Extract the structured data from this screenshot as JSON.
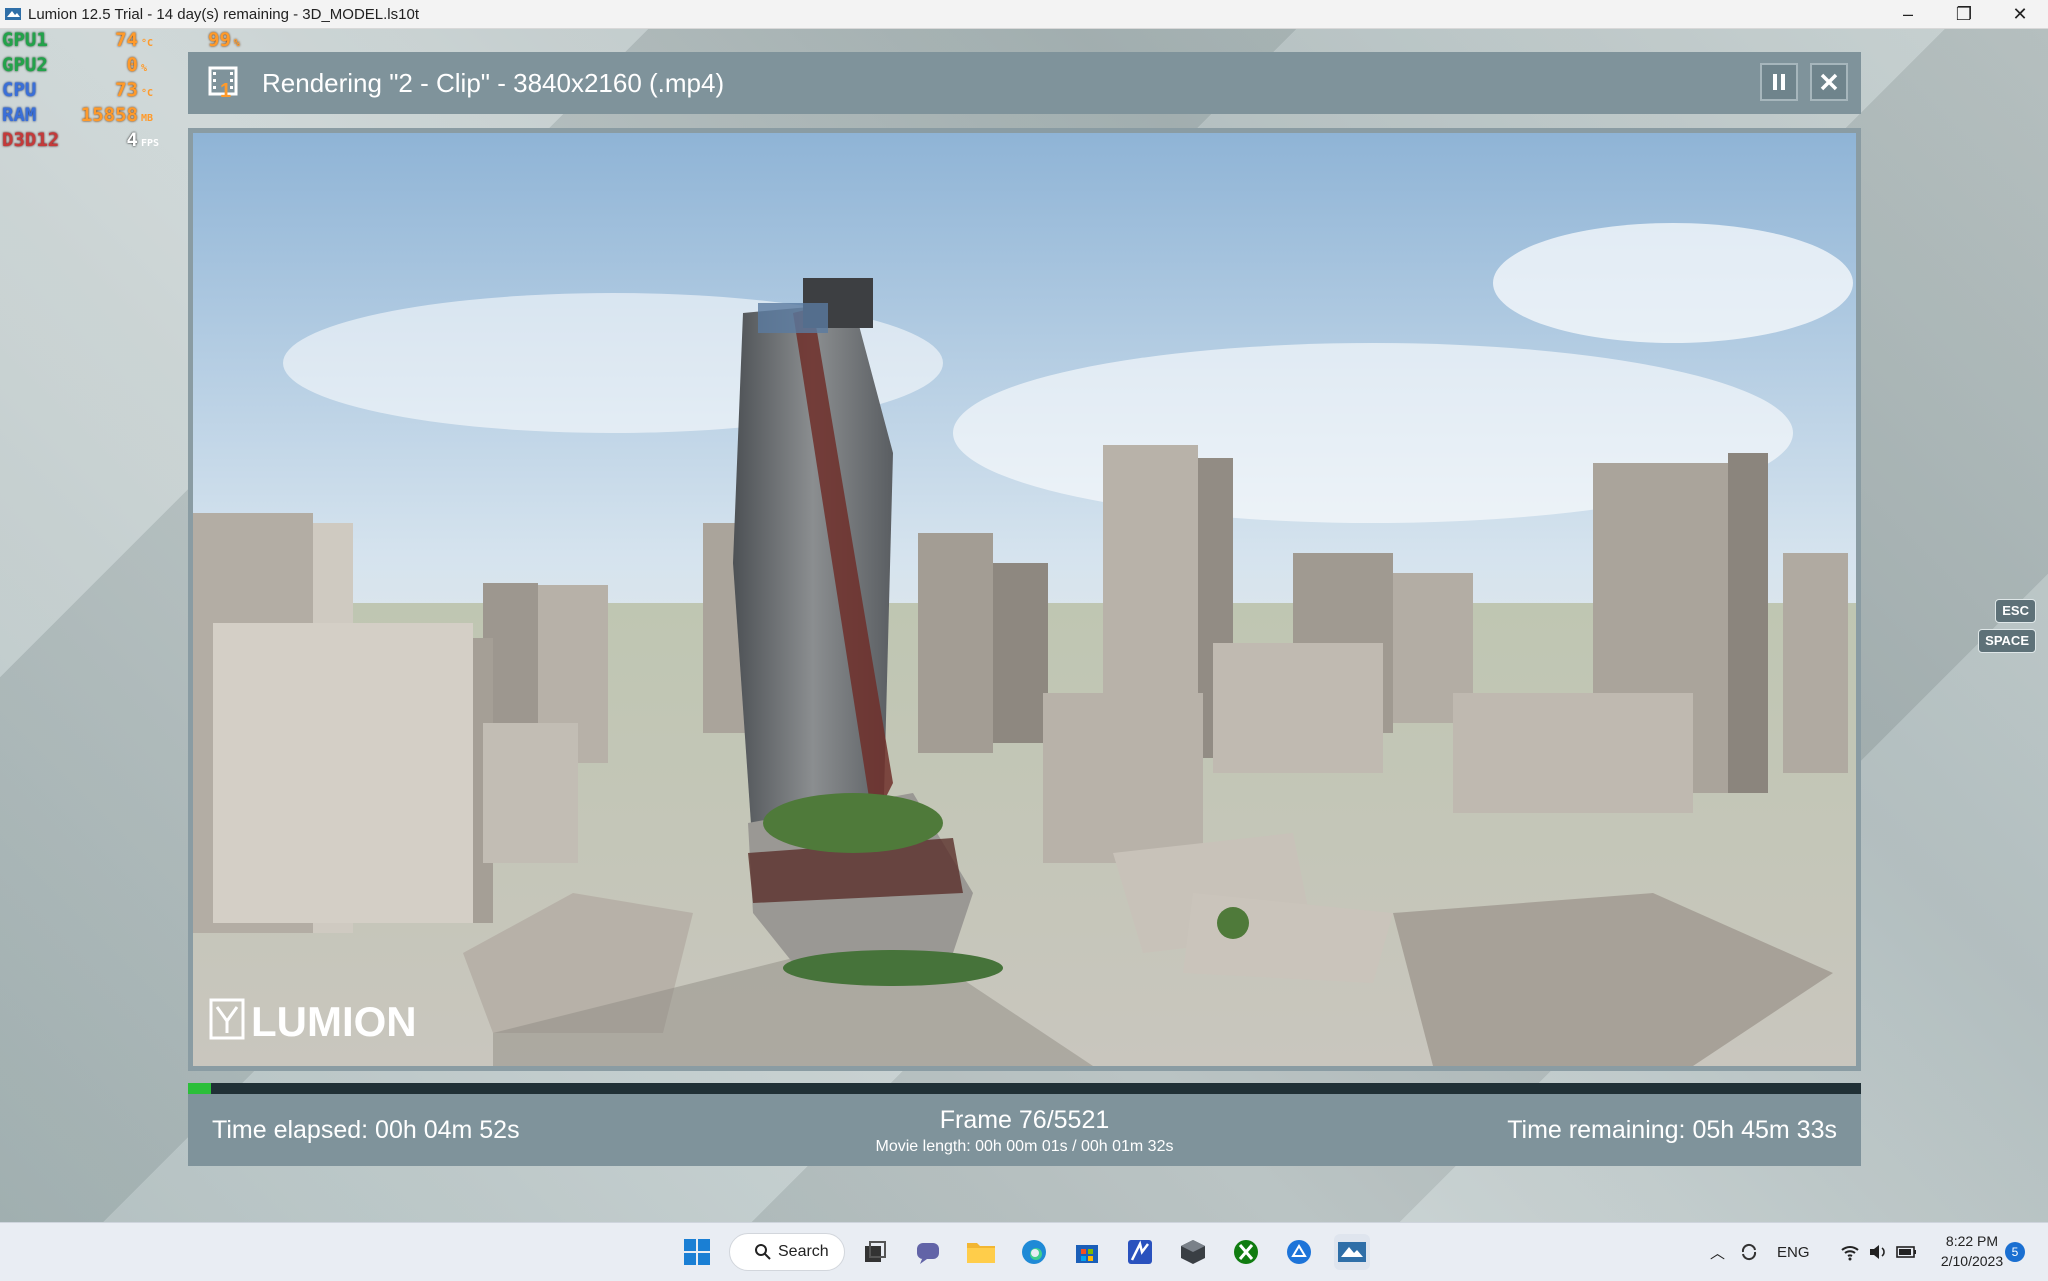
{
  "window": {
    "title": "Lumion 12.5 Trial - 14 day(s) remaining - 3D_MODEL.ls10t",
    "minimize": "–",
    "restore": "❐",
    "close": "✕"
  },
  "overlay": {
    "rows": [
      {
        "label": "GPU1",
        "value": "74",
        "unit": "°C"
      },
      {
        "label": "GPU2",
        "value": "0",
        "unit": "%"
      },
      {
        "label": "CPU",
        "value": "73",
        "unit": "°C"
      },
      {
        "label": "RAM",
        "value": "15858",
        "unit": "MB"
      },
      {
        "label": "D3D12",
        "value": "4",
        "unit": "FPS"
      }
    ],
    "gpu1_load": "99",
    "gpu1_load_unit": "%"
  },
  "render": {
    "header": "Rendering \"2 - Clip\" - 3840x2160 (.mp4)",
    "film_badge": "1",
    "pause_icon": "pause-icon",
    "close_icon": "close-icon",
    "watermark": "LUMION",
    "progress": 0.0138,
    "elapsed": "Time elapsed: 00h 04m 52s",
    "frame": "Frame 76/5521",
    "movie_length": "Movie length: 00h 00m 01s / 00h 01m 32s",
    "remaining": "Time remaining: 05h 45m 33s"
  },
  "keys": {
    "esc": "ESC",
    "space": "SPACE"
  },
  "taskbar": {
    "search_label": "Search",
    "language": "ENG",
    "time": "8:22 PM",
    "date": "2/10/2023",
    "notifications": "5"
  },
  "colors": {
    "panel": "#7f939b",
    "progress": "#2bbf3a",
    "overlay_value": "#ff9a2a"
  }
}
